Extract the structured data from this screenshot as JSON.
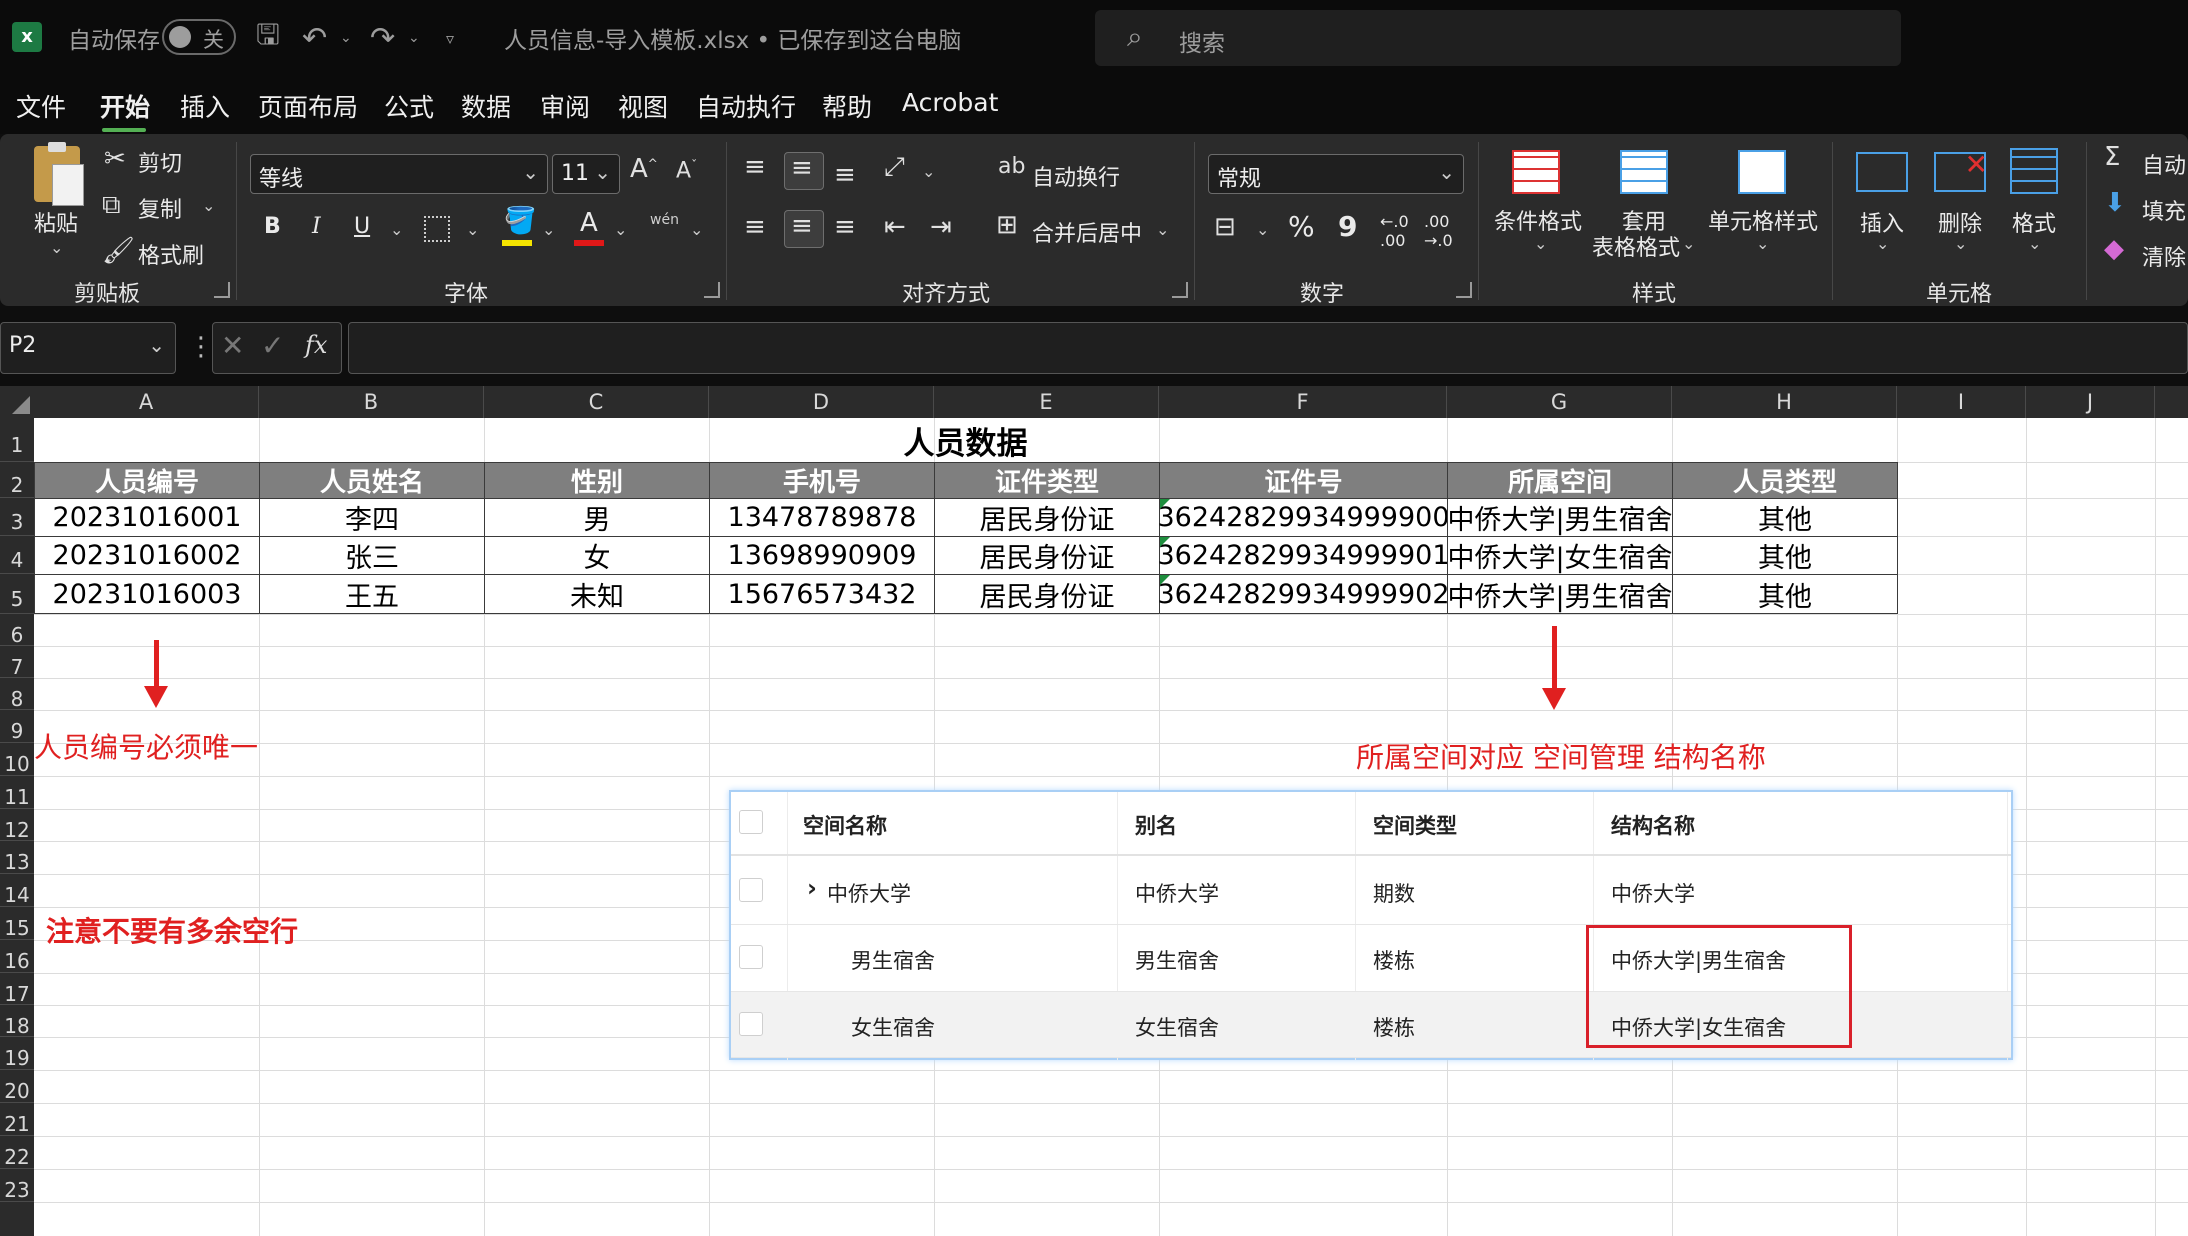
{
  "titlebar": {
    "autosave_label": "自动保存",
    "autosave_state": "关",
    "filename": "人员信息-导入模板.xlsx • 已保存到这台电脑",
    "search_placeholder": "搜索"
  },
  "menu": [
    "文件",
    "开始",
    "插入",
    "页面布局",
    "公式",
    "数据",
    "审阅",
    "视图",
    "自动执行",
    "帮助",
    "Acrobat"
  ],
  "ribbon": {
    "clipboard": {
      "paste": "粘贴",
      "cut": "剪切",
      "copy": "复制",
      "format_painter": "格式刷",
      "group": "剪贴板"
    },
    "font": {
      "name": "等线",
      "size": "11",
      "group": "字体",
      "bold": "B",
      "italic": "I",
      "underline": "U"
    },
    "alignment": {
      "wrap": "自动换行",
      "merge": "合并后居中",
      "group": "对齐方式"
    },
    "number": {
      "format": "常规",
      "group": "数字",
      "percent": "%",
      "comma": "9"
    },
    "styles": {
      "conditional": "条件格式",
      "table_format_1": "套用",
      "table_format_2": "表格格式",
      "cell_styles": "单元格样式",
      "group": "样式"
    },
    "cells": {
      "insert": "插入",
      "delete": "删除",
      "format": "格式",
      "group": "单元格"
    },
    "editing": {
      "autosum": "自动",
      "fill": "填充",
      "clear": "清除"
    }
  },
  "formula_bar": {
    "name_box": "P2",
    "fx": "fx",
    "value": ""
  },
  "columns": [
    "A",
    "B",
    "C",
    "D",
    "E",
    "F",
    "G",
    "H",
    "I",
    "J"
  ],
  "rows": [
    "1",
    "2",
    "3",
    "4",
    "5",
    "6",
    "7",
    "8",
    "9",
    "10",
    "11",
    "12",
    "13",
    "14",
    "15",
    "16",
    "17",
    "18",
    "19",
    "20",
    "21",
    "22",
    "23"
  ],
  "sheet": {
    "title": "人员数据",
    "headers": [
      "人员编号",
      "人员姓名",
      "性别",
      "手机号",
      "证件类型",
      "证件号",
      "所属空间",
      "人员类型"
    ],
    "rows": [
      [
        "20231016001",
        "李四",
        "男",
        "13478789878",
        "居民身份证",
        "36242829934999900",
        "中侨大学|男生宿舍",
        "其他"
      ],
      [
        "20231016002",
        "张三",
        "女",
        "13698990909",
        "居民身份证",
        "36242829934999901",
        "中侨大学|女生宿舍",
        "其他"
      ],
      [
        "20231016003",
        "王五",
        "未知",
        "15676573432",
        "居民身份证",
        "36242829934999902",
        "中侨大学|男生宿舍",
        "其他"
      ]
    ]
  },
  "annotations": {
    "unique_id": "人员编号必须唯一",
    "no_blank_rows": "注意不要有多余空行",
    "space_mapping": "所属空间对应 空间管理 结构名称"
  },
  "space_table": {
    "headers": [
      "空间名称",
      "别名",
      "空间类型",
      "结构名称"
    ],
    "rows": [
      [
        "中侨大学",
        "中侨大学",
        "期数",
        "中侨大学"
      ],
      [
        "男生宿舍",
        "男生宿舍",
        "楼栋",
        "中侨大学|男生宿舍"
      ],
      [
        "女生宿舍",
        "女生宿舍",
        "楼栋",
        "中侨大学|女生宿舍"
      ]
    ],
    "expand_glyph": "›"
  }
}
